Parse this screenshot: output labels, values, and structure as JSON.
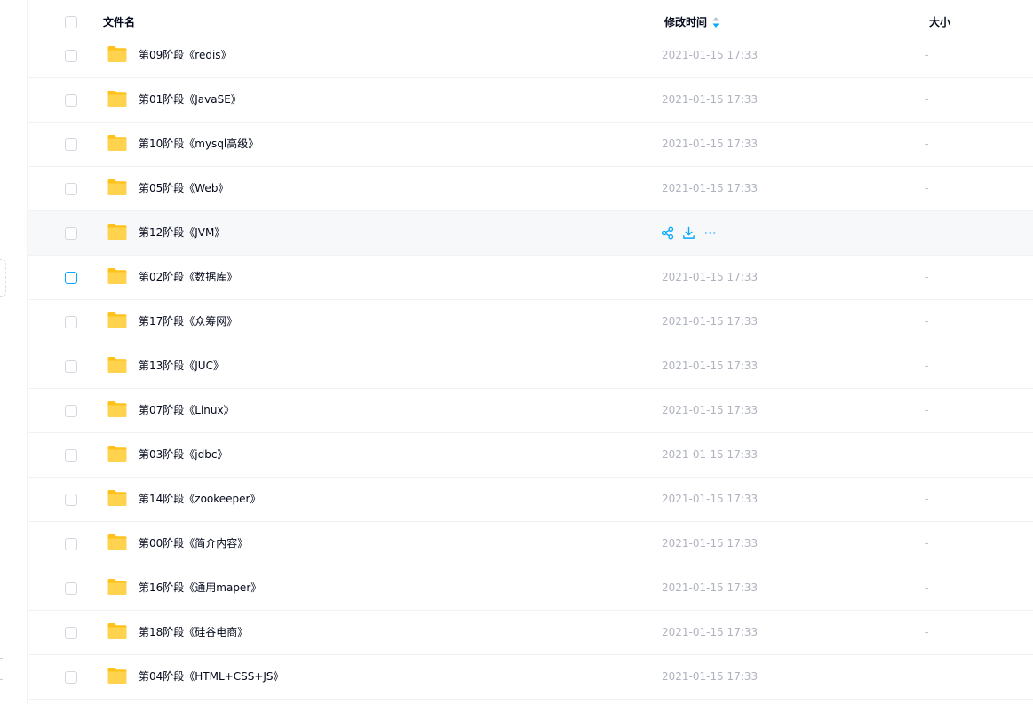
{
  "header": {
    "name_label": "文件名",
    "time_label": "修改时间",
    "size_label": "大小"
  },
  "colors": {
    "accent": "#06a7ff",
    "folder": "#ffd34d",
    "muted_text": "#afb3bf"
  },
  "rows": [
    {
      "name": "第09阶段《redis》",
      "time": "2021-01-15 17:33",
      "size": "-"
    },
    {
      "name": "第01阶段《JavaSE》",
      "time": "2021-01-15 17:33",
      "size": "-"
    },
    {
      "name": "第10阶段《mysql高级》",
      "time": "2021-01-15 17:33",
      "size": "-"
    },
    {
      "name": "第05阶段《Web》",
      "time": "2021-01-15 17:33",
      "size": "-"
    },
    {
      "name": "第12阶段《JVM》",
      "time": "",
      "size": "-",
      "hovered": true
    },
    {
      "name": "第02阶段《数据库》",
      "time": "2021-01-15 17:33",
      "size": "-",
      "checkbox_focused": true
    },
    {
      "name": "第17阶段《众筹网》",
      "time": "2021-01-15 17:33",
      "size": "-"
    },
    {
      "name": "第13阶段《JUC》",
      "time": "2021-01-15 17:33",
      "size": "-"
    },
    {
      "name": "第07阶段《Linux》",
      "time": "2021-01-15 17:33",
      "size": "-"
    },
    {
      "name": "第03阶段《jdbc》",
      "time": "2021-01-15 17:33",
      "size": "-"
    },
    {
      "name": "第14阶段《zookeeper》",
      "time": "2021-01-15 17:33",
      "size": "-"
    },
    {
      "name": "第00阶段《简介内容》",
      "time": "2021-01-15 17:33",
      "size": "-"
    },
    {
      "name": "第16阶段《通用maper》",
      "time": "2021-01-15 17:33",
      "size": "-"
    },
    {
      "name": "第18阶段《硅谷电商》",
      "time": "2021-01-15 17:33",
      "size": "-"
    },
    {
      "name": "第04阶段《HTML+CSS+JS》",
      "time": "2021-01-15 17:33",
      "size": ""
    }
  ],
  "hover_actions": [
    "share-icon",
    "download-icon",
    "more-icon"
  ]
}
